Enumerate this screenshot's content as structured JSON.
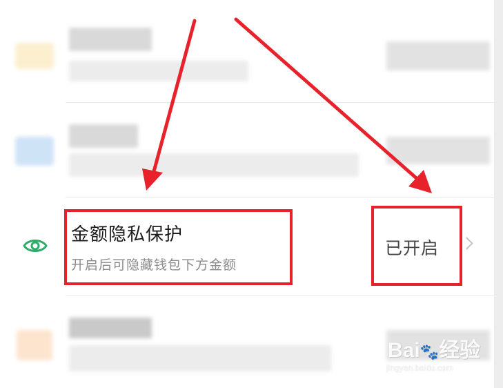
{
  "setting_row": {
    "title": "金额隐私保护",
    "subtitle": "开启后可隐藏钱包下方金额",
    "status": "已开启"
  },
  "icons": {
    "eye": "eye-icon",
    "chevron": "chevron-right-icon"
  },
  "colors": {
    "accent_green": "#2aae67",
    "annotation_red": "#e8222b",
    "title_text": "#1a1a1a",
    "subtitle_text": "#8a8a8a"
  },
  "watermark": {
    "brand": "Bai",
    "brand_suffix": "经验",
    "domain": "jingyan.baidu.com"
  }
}
